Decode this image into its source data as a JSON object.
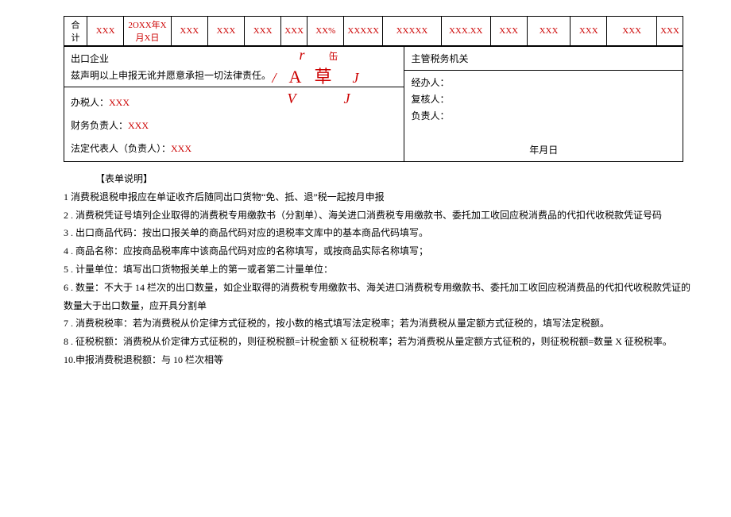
{
  "table": {
    "row_label": "合计",
    "c1": "XXX",
    "c2": "2OXX年X月X日",
    "c3": "XXX",
    "c4": "XXX",
    "c5": "XXX",
    "c6": "XXX",
    "c7": "XX%",
    "c8": "XXXXX",
    "c9": "XXXXX",
    "c10": "XXX.XX",
    "c11": "XXX",
    "c12": "XXX",
    "c13": "XXX",
    "c14": "XXX",
    "c15": "XXX"
  },
  "sig_left": {
    "l1": "出口企业",
    "l2": "兹声明以上申报无讹并愿意承担一切法律责任。",
    "l3a": "办税人：",
    "l3b": "XXX",
    "l4a": "财务负责人：",
    "l4b": "XXX",
    "l5a": "法定代表人（负责人）：",
    "l5b": "XXX"
  },
  "stamp": {
    "r": "r",
    "can": "缶",
    "slash": "/",
    "A": "A",
    "cao": "草",
    "J1": "J",
    "V": "V",
    "J2": "J"
  },
  "sig_right": {
    "h": "主管税务机关",
    "r1": "经办人：",
    "r2": "复核人：",
    "r3": "负责人：",
    "date": "年月日"
  },
  "notes": {
    "title": "【表单说明】",
    "n1": "1 消费税退税申报应在单证收齐后随同出口货物“免、抵、退”税一起按月申报",
    "n2": "2 . 消费税凭证号填列企业取得的消费税专用缴款书（分割单）、海关进口消费税专用缴款书、委托加工收回应税消费品的代扣代收税款凭证号码",
    "n3": "3  . 出口商品代码：按出口报关单的商品代码对应的退税率文库中的基本商品代码填写。",
    "n4": "4  . 商品名称：应按商品税率库中该商品代码对应的名称填写，或按商品实际名称填写；",
    "n5": "5  . 计量单位：填写出口货物报关单上的第一或者第二计量单位：",
    "n6": "6  . 数量：不大于 14 栏次的出口数量，如企业取得的消费税专用缴款书、海关进口消费税专用缴款书、委托加工收回应税消费品的代扣代收税款凭证的数量大于出口数量，应开具分割单",
    "n7": "7  . 消费税税率：若为消费税从价定律方式征税的，按小数的格式填写法定税率；若为消费税从量定额方式征税的，填写法定税额。",
    "n8": "8  . 征税税额：消费税从价定律方式征税的，则征税税额=计税金额 X 征税税率；若为消费税从量定额方式征税的，则征税税额=数量 X 征税税率。",
    "n10": "10.申报消费税退税额：与 10 栏次相等"
  }
}
